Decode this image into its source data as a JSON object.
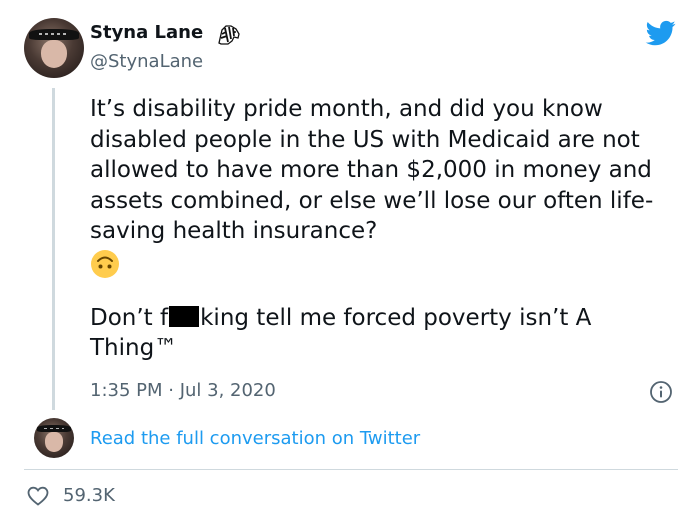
{
  "user": {
    "display_name": "Styna Lane",
    "handle": "@StynaLane",
    "badge_icon": "zebra-icon"
  },
  "tweet": {
    "line1": "It’s disability pride month, and did you know disabled people in the US with Medicaid are not allowed to have more than $2,000 in money and assets combined, or else we’ll lose our often life-saving health insurance?",
    "emoji": "upside-down-face-emoji",
    "line2_pre": "Don’t f",
    "line2_post": "king tell me forced poverty isn’t A Thing™",
    "timestamp": "1:35 PM · Jul 3, 2020"
  },
  "conversation_link": "Read the full conversation on Twitter",
  "likes": "59.3K",
  "colors": {
    "twitter_blue": "#1d9bf0",
    "secondary_text": "#536471",
    "divider": "#cfd9de"
  }
}
